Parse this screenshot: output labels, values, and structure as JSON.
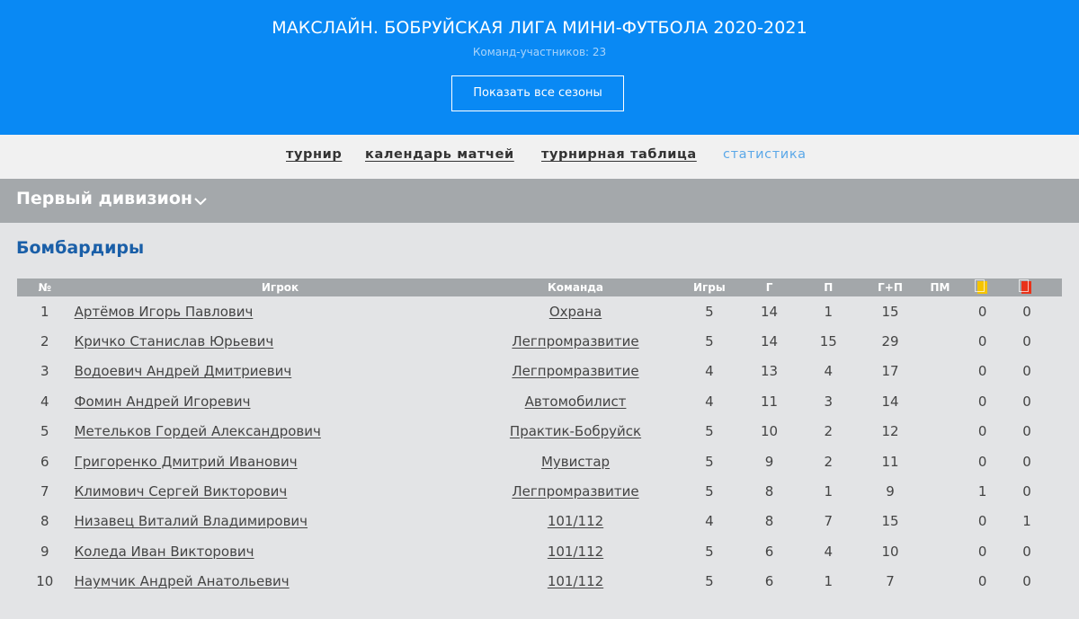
{
  "header": {
    "title": "МАКСЛАЙН. БОБРУЙСКАЯ ЛИГА МИНИ-ФУТБОЛА 2020-2021",
    "subtitle": "Команд-участников: 23",
    "seasons_button": "Показать все сезоны"
  },
  "nav": {
    "items": [
      {
        "label": "турнир"
      },
      {
        "label": "календарь матчей"
      },
      {
        "label": "турнирная таблица"
      },
      {
        "label": "статистика"
      }
    ]
  },
  "division": {
    "label": "Первый дивизион",
    "icon": "chevron-down-icon"
  },
  "section": {
    "title": "Бомбардиры"
  },
  "table": {
    "columns": [
      "№",
      "Игрок",
      "Команда",
      "Игры",
      "Г",
      "П",
      "Г+П",
      "ПМ"
    ],
    "card_icons": [
      "yellow-card-icon",
      "red-card-icon"
    ],
    "colors": {
      "yellow_card": "#f5c400",
      "red_card": "#e8331a",
      "header_bg": "#0989f4"
    },
    "rows": [
      {
        "num": "1",
        "player": "Артёмов Игорь Павлович",
        "team": "Охрана",
        "games": "5",
        "goals": "14",
        "assists": "1",
        "points": "15",
        "pm": "",
        "yellow": "0",
        "red": "0"
      },
      {
        "num": "2",
        "player": "Кричко Станислав Юрьевич",
        "team": "Легпромразвитие",
        "games": "5",
        "goals": "14",
        "assists": "15",
        "points": "29",
        "pm": "",
        "yellow": "0",
        "red": "0"
      },
      {
        "num": "3",
        "player": "Водоевич Андрей Дмитриевич",
        "team": "Легпромразвитие",
        "games": "4",
        "goals": "13",
        "assists": "4",
        "points": "17",
        "pm": "",
        "yellow": "0",
        "red": "0"
      },
      {
        "num": "4",
        "player": "Фомин Андрей Игоревич",
        "team": "Автомобилист",
        "games": "4",
        "goals": "11",
        "assists": "3",
        "points": "14",
        "pm": "",
        "yellow": "0",
        "red": "0"
      },
      {
        "num": "5",
        "player": "Метельков Гордей Александрович",
        "team": "Практик-Бобруйск",
        "games": "5",
        "goals": "10",
        "assists": "2",
        "points": "12",
        "pm": "",
        "yellow": "0",
        "red": "0"
      },
      {
        "num": "6",
        "player": "Григоренко Дмитрий Иванович",
        "team": "Мувистар",
        "games": "5",
        "goals": "9",
        "assists": "2",
        "points": "11",
        "pm": "",
        "yellow": "0",
        "red": "0"
      },
      {
        "num": "7",
        "player": "Климович Сергей Викторович",
        "team": "Легпромразвитие",
        "games": "5",
        "goals": "8",
        "assists": "1",
        "points": "9",
        "pm": "",
        "yellow": "1",
        "red": "0"
      },
      {
        "num": "8",
        "player": "Низавец Виталий Владимирович",
        "team": "101/112",
        "games": "4",
        "goals": "8",
        "assists": "7",
        "points": "15",
        "pm": "",
        "yellow": "0",
        "red": "1"
      },
      {
        "num": "9",
        "player": "Коледа Иван Викторович",
        "team": "101/112",
        "games": "5",
        "goals": "6",
        "assists": "4",
        "points": "10",
        "pm": "",
        "yellow": "0",
        "red": "0"
      },
      {
        "num": "10",
        "player": "Наумчик Андрей Анатольевич",
        "team": "101/112",
        "games": "5",
        "goals": "6",
        "assists": "1",
        "points": "7",
        "pm": "",
        "yellow": "0",
        "red": "0"
      }
    ]
  }
}
